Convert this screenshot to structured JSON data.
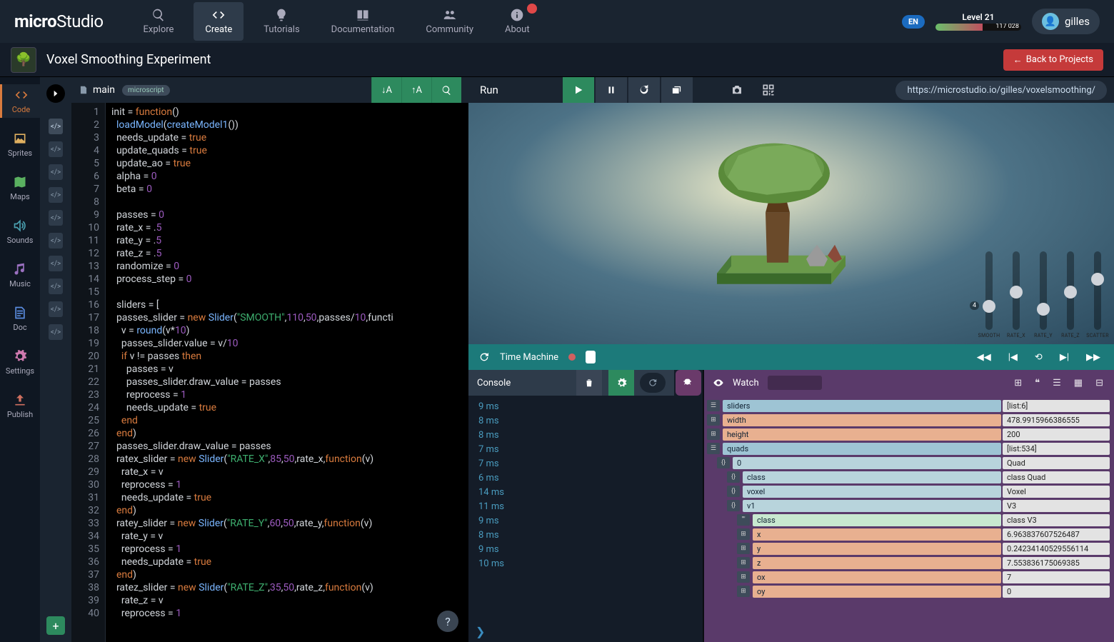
{
  "header": {
    "logo_micro": "micro",
    "logo_studio": "Studio",
    "nav": {
      "explore": "Explore",
      "create": "Create",
      "tutorials": "Tutorials",
      "documentation": "Documentation",
      "community": "Community",
      "about": "About"
    },
    "language": "EN",
    "level_label": "Level 21",
    "level_points": "117 028",
    "username": "gilles"
  },
  "project": {
    "title": "Voxel Smoothing Experiment",
    "back_label": "Back to Projects"
  },
  "sidebar": {
    "items": [
      {
        "label": "Code",
        "icon": "code"
      },
      {
        "label": "Sprites",
        "icon": "image"
      },
      {
        "label": "Maps",
        "icon": "map"
      },
      {
        "label": "Sounds",
        "icon": "sound"
      },
      {
        "label": "Music",
        "icon": "music"
      },
      {
        "label": "Doc",
        "icon": "doc"
      },
      {
        "label": "Settings",
        "icon": "gear"
      },
      {
        "label": "Publish",
        "icon": "upload"
      }
    ]
  },
  "editor": {
    "filename": "main",
    "language_tag": "microscript",
    "file_count": 10,
    "tools": {
      "sort_asc": "↓A",
      "sort_desc": "↑A"
    },
    "code_lines": [
      "init = function()",
      "  loadModel(createModel1())",
      "  needs_update = true",
      "  update_quads = true",
      "  update_ao = true",
      "  alpha = 0",
      "  beta = 0",
      "",
      "  passes = 0",
      "  rate_x = .5",
      "  rate_y = .5",
      "  rate_z = .5",
      "  randomize = 0",
      "  process_step = 0",
      "",
      "  sliders = [",
      "  passes_slider = new Slider(\"SMOOTH\",110,50,passes/10,functi",
      "    v = round(v*10)",
      "    passes_slider.value = v/10",
      "    if v != passes then",
      "      passes = v",
      "      passes_slider.draw_value = passes",
      "      reprocess = 1",
      "      needs_update = true",
      "    end",
      "  end)",
      "  passes_slider.draw_value = passes",
      "  ratex_slider = new Slider(\"RATE_X\",85,50,rate_x,function(v)",
      "    rate_x = v",
      "    reprocess = 1",
      "    needs_update = true",
      "  end)",
      "  ratey_slider = new Slider(\"RATE_Y\",60,50,rate_y,function(v)",
      "    rate_y = v",
      "    reprocess = 1",
      "    needs_update = true",
      "  end)",
      "  ratez_slider = new Slider(\"RATE_Z\",35,50,rate_z,function(v)",
      "    rate_z = v",
      "    reprocess = 1"
    ]
  },
  "runbar": {
    "run_label": "Run",
    "url": "https://microstudio.io/gilles/voxelsmoothing/"
  },
  "time_machine": {
    "label": "Time Machine"
  },
  "console": {
    "title": "Console",
    "lines": [
      "9 ms",
      "8 ms",
      "8 ms",
      "7 ms",
      "7 ms",
      "6 ms",
      "14 ms",
      "11 ms",
      "9 ms",
      "8 ms",
      "9 ms",
      "10 ms"
    ]
  },
  "watch": {
    "title": "Watch",
    "sliders_overlay": [
      {
        "label": "SMOOTH",
        "badge": "4",
        "pos": 68
      },
      {
        "label": "RATE_X",
        "pos": 48
      },
      {
        "label": "RATE_Y",
        "pos": 72
      },
      {
        "label": "RATE_Z",
        "pos": 48
      },
      {
        "label": "SCATTER",
        "pos": 30
      }
    ],
    "rows": [
      {
        "depth": 0,
        "type": "list",
        "name": "sliders",
        "value": "[list:6]"
      },
      {
        "depth": 0,
        "type": "num",
        "name": "width",
        "value": "478.9915966386555"
      },
      {
        "depth": 0,
        "type": "num",
        "name": "height",
        "value": "200"
      },
      {
        "depth": 0,
        "type": "list",
        "name": "quads",
        "value": "[list:534]"
      },
      {
        "depth": 1,
        "type": "obj",
        "name": "0",
        "value": "Quad"
      },
      {
        "depth": 2,
        "type": "obj",
        "name": "class",
        "value": "class Quad"
      },
      {
        "depth": 2,
        "type": "obj",
        "name": "voxel",
        "value": "Voxel"
      },
      {
        "depth": 2,
        "type": "obj",
        "name": "v1",
        "value": "V3"
      },
      {
        "depth": 3,
        "type": "txt",
        "name": "class",
        "value": "class V3"
      },
      {
        "depth": 3,
        "type": "num",
        "name": "x",
        "value": "6.963837607526487"
      },
      {
        "depth": 3,
        "type": "num",
        "name": "y",
        "value": "0.24234140529556114"
      },
      {
        "depth": 3,
        "type": "num",
        "name": "z",
        "value": "7.553836175069385"
      },
      {
        "depth": 3,
        "type": "num",
        "name": "ox",
        "value": "7"
      },
      {
        "depth": 3,
        "type": "num",
        "name": "oy",
        "value": "0"
      }
    ]
  }
}
